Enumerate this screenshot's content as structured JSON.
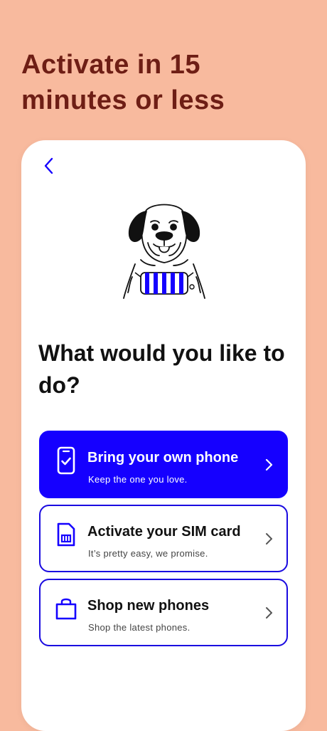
{
  "headline": "Activate in 15 minutes or less",
  "screen": {
    "question": "What would you like to do?",
    "options": [
      {
        "title": "Bring your own phone",
        "subtitle": "Keep the one you love.",
        "icon": "phone-check-icon"
      },
      {
        "title": "Activate your SIM card",
        "subtitle": "It’s pretty easy, we promise.",
        "icon": "sim-card-icon"
      },
      {
        "title": "Shop new phones",
        "subtitle": "Shop the latest phones.",
        "icon": "shopping-bag-icon"
      }
    ]
  },
  "colors": {
    "background": "#F8BA9E",
    "headline": "#6E1E15",
    "accent": "#1500FF",
    "card": "#FFFFFF"
  }
}
